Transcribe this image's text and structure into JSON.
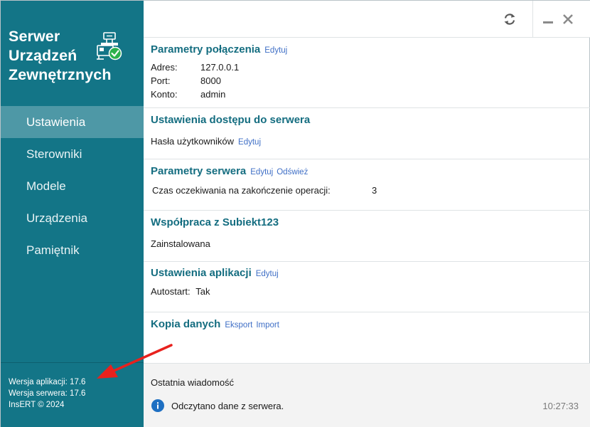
{
  "app": {
    "title_lines": [
      "Serwer",
      "Urządzeń",
      "Zewnętrznych"
    ]
  },
  "sidebar": {
    "items": [
      {
        "label": "Ustawienia",
        "active": true
      },
      {
        "label": "Sterowniki",
        "active": false
      },
      {
        "label": "Modele",
        "active": false
      },
      {
        "label": "Urządzenia",
        "active": false
      },
      {
        "label": "Pamiętnik",
        "active": false
      }
    ],
    "footer": {
      "app_version": "Wersja aplikacji: 17.6",
      "server_version": "Wersja serwera: 17.6",
      "copyright": "InsERT © 2024"
    }
  },
  "toolbar": {
    "icons": [
      "refresh-icon",
      "minimize-icon",
      "close-icon"
    ]
  },
  "sections": {
    "connection": {
      "title": "Parametry połączenia",
      "edit_link": "Edytuj",
      "rows": [
        {
          "label": "Adres:",
          "value": "127.0.0.1"
        },
        {
          "label": "Port:",
          "value": "8000"
        },
        {
          "label": "Konto:",
          "value": "admin"
        }
      ]
    },
    "access": {
      "title": "Ustawienia dostępu do serwera",
      "passwords_label": "Hasła użytkowników",
      "edit_link": "Edytuj"
    },
    "server_params": {
      "title": "Parametry serwera",
      "edit_link": "Edytuj",
      "refresh_link": "Odśwież",
      "timeout_label": "Czas oczekiwania na zakończenie operacji:",
      "timeout_value": "3"
    },
    "subiekt": {
      "title": "Współpraca z Subiekt123",
      "status": "Zainstalowana"
    },
    "app_settings": {
      "title": "Ustawienia aplikacji",
      "edit_link": "Edytuj",
      "autostart_label": "Autostart:",
      "autostart_value": "Tak"
    },
    "backup": {
      "title": "Kopia danych",
      "export_link": "Eksport",
      "import_link": "Import"
    }
  },
  "status": {
    "title": "Ostatnia wiadomość",
    "message": "Odczytano dane z serwera.",
    "time": "10:27:33",
    "icon": "info-icon"
  },
  "colors": {
    "sidebar_bg": "#137587",
    "sidebar_active": "#4e98a6",
    "section_title": "#146d80",
    "link": "#3f6fc6",
    "annotation_arrow": "#e8211d"
  }
}
